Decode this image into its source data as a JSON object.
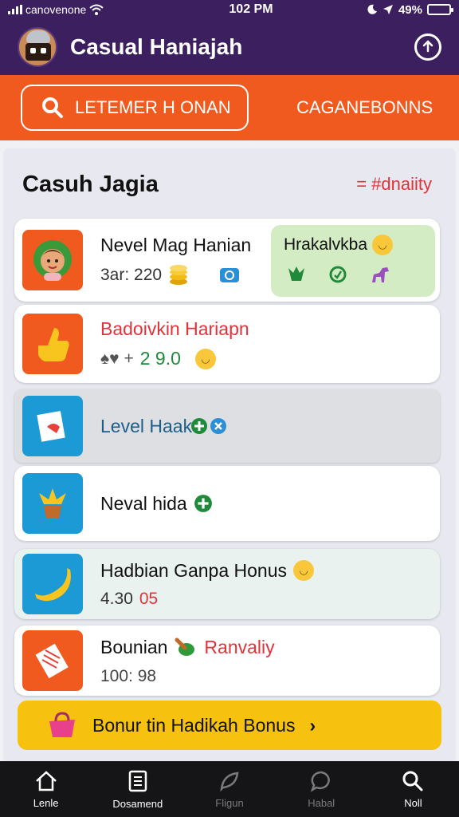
{
  "status_bar": {
    "carrier": "canovenone",
    "time": "102 PM",
    "battery_percent": "49%",
    "battery_level": 0.8
  },
  "header": {
    "title": "Casual Haniajah"
  },
  "tabs": {
    "search_label": "LETEMER H ONAN",
    "bonus_label": "CAGANEBONNS"
  },
  "section": {
    "title": "Casuh Jagia",
    "link": "= #dnaiity"
  },
  "items": [
    {
      "name": "Nevel Mag Hanian",
      "sub": "3ar: 220"
    },
    {
      "name": "Badoivkin Hariapn",
      "sub": "2 9.0",
      "sub_prefix": "♠♥ +"
    },
    {
      "name": "Level Haak"
    },
    {
      "name": "Neval hida"
    },
    {
      "name": "Hadbian Ganpa Honus",
      "sub": "4.30",
      "sub_extra": "05"
    },
    {
      "name": "Bounian",
      "name_extra": "Ranvaliy",
      "sub": "100: 98"
    }
  ],
  "highlight_panel": {
    "title": "Hrakalvkba"
  },
  "banner": {
    "text": "Bonur tin  Hadikah  Bonus",
    "chevron": "›"
  },
  "bottom_nav": [
    {
      "label": "Lenle"
    },
    {
      "label": "Dosamend"
    },
    {
      "label": "Fligun"
    },
    {
      "label": "Habal"
    },
    {
      "label": "Noll"
    }
  ],
  "colors": {
    "header_bg": "#3b1f5e",
    "accent_orange": "#f15a1e",
    "banner_yellow": "#f6c20f",
    "link_red": "#e2323a",
    "nav_bg": "#151517"
  }
}
